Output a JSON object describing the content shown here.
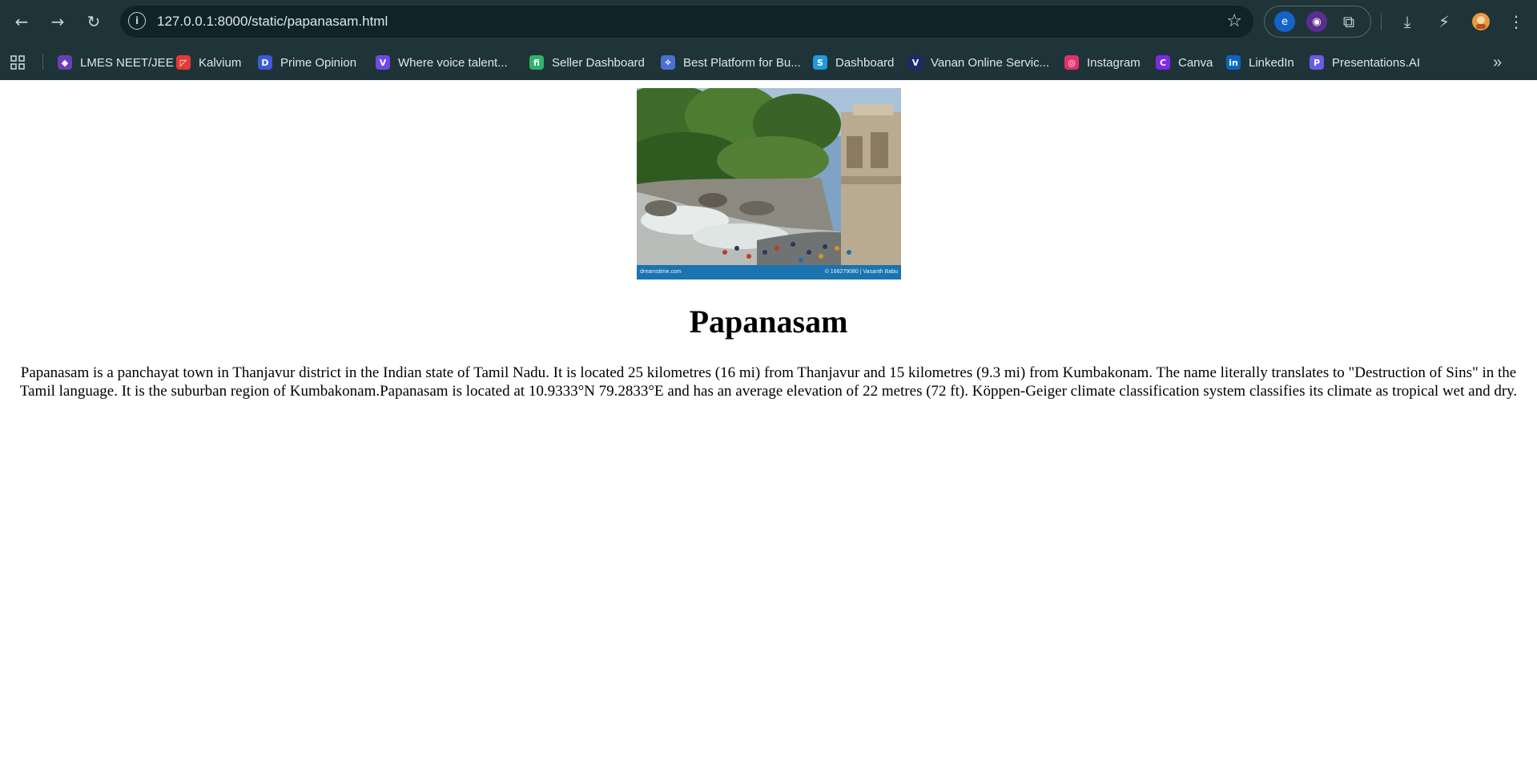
{
  "browser": {
    "url": "127.0.0.1:8000/static/papanasam.html",
    "bookmarks": [
      {
        "label": "LMES NEET/JEE",
        "icon": "lmes-icon",
        "color": "#6a3fb5"
      },
      {
        "label": "Kalvium",
        "icon": "kalvium-icon",
        "color": "#e53935"
      },
      {
        "label": "Prime Opinion",
        "icon": "prime-opinion-icon",
        "color": "#3b5bdb"
      },
      {
        "label": "Where voice talent...",
        "icon": "voice-icon",
        "color": "#7048e8"
      },
      {
        "label": "Seller Dashboard",
        "icon": "seller-icon",
        "color": "#2fb36b"
      },
      {
        "label": "Best Platform for Bu...",
        "icon": "platform-icon",
        "color": "#4a6fd6"
      },
      {
        "label": "Dashboard",
        "icon": "dashboard-icon",
        "color": "#1e9be0"
      },
      {
        "label": "Vanan Online Servic...",
        "icon": "vanan-icon",
        "color": "#1b2a6b"
      },
      {
        "label": "Instagram",
        "icon": "instagram-icon",
        "color": "#e1306c"
      },
      {
        "label": "Canva",
        "icon": "canva-icon",
        "color": "#7d2ae8"
      },
      {
        "label": "LinkedIn",
        "icon": "linkedin-icon",
        "color": "#0a66c2"
      },
      {
        "label": "Presentations.AI",
        "icon": "presentations-icon",
        "color": "#6b5ce7"
      }
    ]
  },
  "page": {
    "image_watermark_left": "dreamstime.com",
    "image_watermark_right": "© 166279080 | Vasanth Babu",
    "title": "Papanasam",
    "description": "Papanasam is a panchayat town in Thanjavur district in the Indian state of Tamil Nadu. It is located 25 kilometres (16 mi) from Thanjavur and 15 kilometres (9.3 mi) from Kumbakonam. The name literally translates to \"Destruction of Sins\" in the Tamil language. It is the suburban region of Kumbakonam.Papanasam is located at 10.9333°N 79.2833°E and has an average elevation of 22 metres (72 ft). Köppen-Geiger climate classification system classifies its climate as tropical wet and dry."
  }
}
